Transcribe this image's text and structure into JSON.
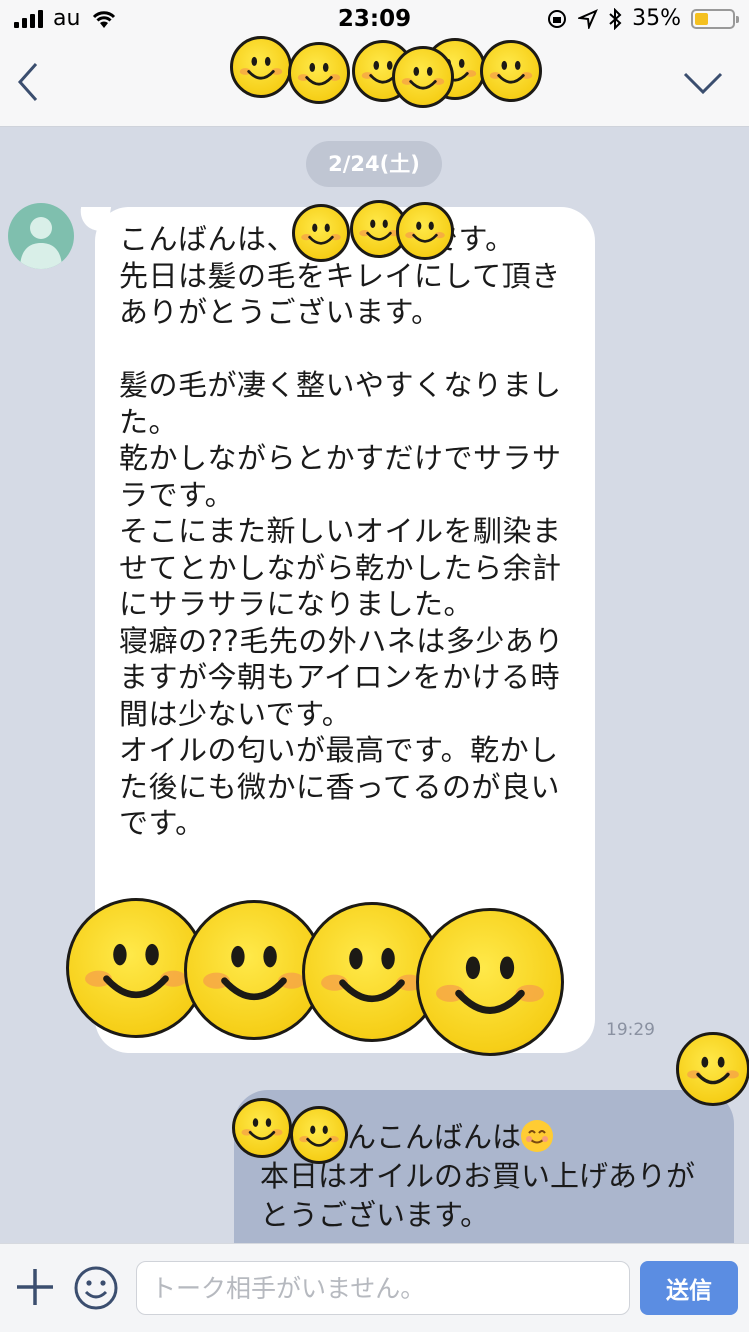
{
  "status_bar": {
    "carrier": "au",
    "time": "23:09",
    "battery_percent": "35%",
    "battery_level": 0.35,
    "icons": [
      "signal-icon",
      "wifi-icon",
      "orientation-lock-icon",
      "location-icon",
      "bluetooth-icon",
      "battery-icon"
    ]
  },
  "header": {
    "back_icon": "chevron-left-icon",
    "menu_icon": "chevron-down-icon"
  },
  "chat": {
    "date_label": "2/24(土)",
    "incoming": {
      "text": "こんばんは、　　　　　です。\n先日は髪の毛をキレイにして頂きありがとうございます。\n\n髪の毛が凄く整いやすくなりました。\n乾かしながらとかすだけでサラサラです。\nそこにまた新しいオイルを馴染ませてとかしながら乾かしたら余計にサラサラになりました。\n寝癖の??毛先の外ハネは多少ありますが今朝もアイロンをかける時間は少ないです。\nオイルの匂いが最高です。乾かした後にも微かに香ってるのが良いです。",
      "time": "19:29"
    },
    "outgoing": {
      "text_line1": "　　　んこんばんは",
      "text_rest": "本日はオイルのお買い上げありがとうございます。"
    }
  },
  "input_bar": {
    "placeholder": "トーク相手がいません。",
    "send_label": "送信"
  },
  "colors": {
    "background": "#d5dae5",
    "incoming_bubble": "#ffffff",
    "outgoing_bubble": "#abb6cd",
    "send_button": "#5b8de2",
    "redaction_smiley": "#f6cf18"
  }
}
